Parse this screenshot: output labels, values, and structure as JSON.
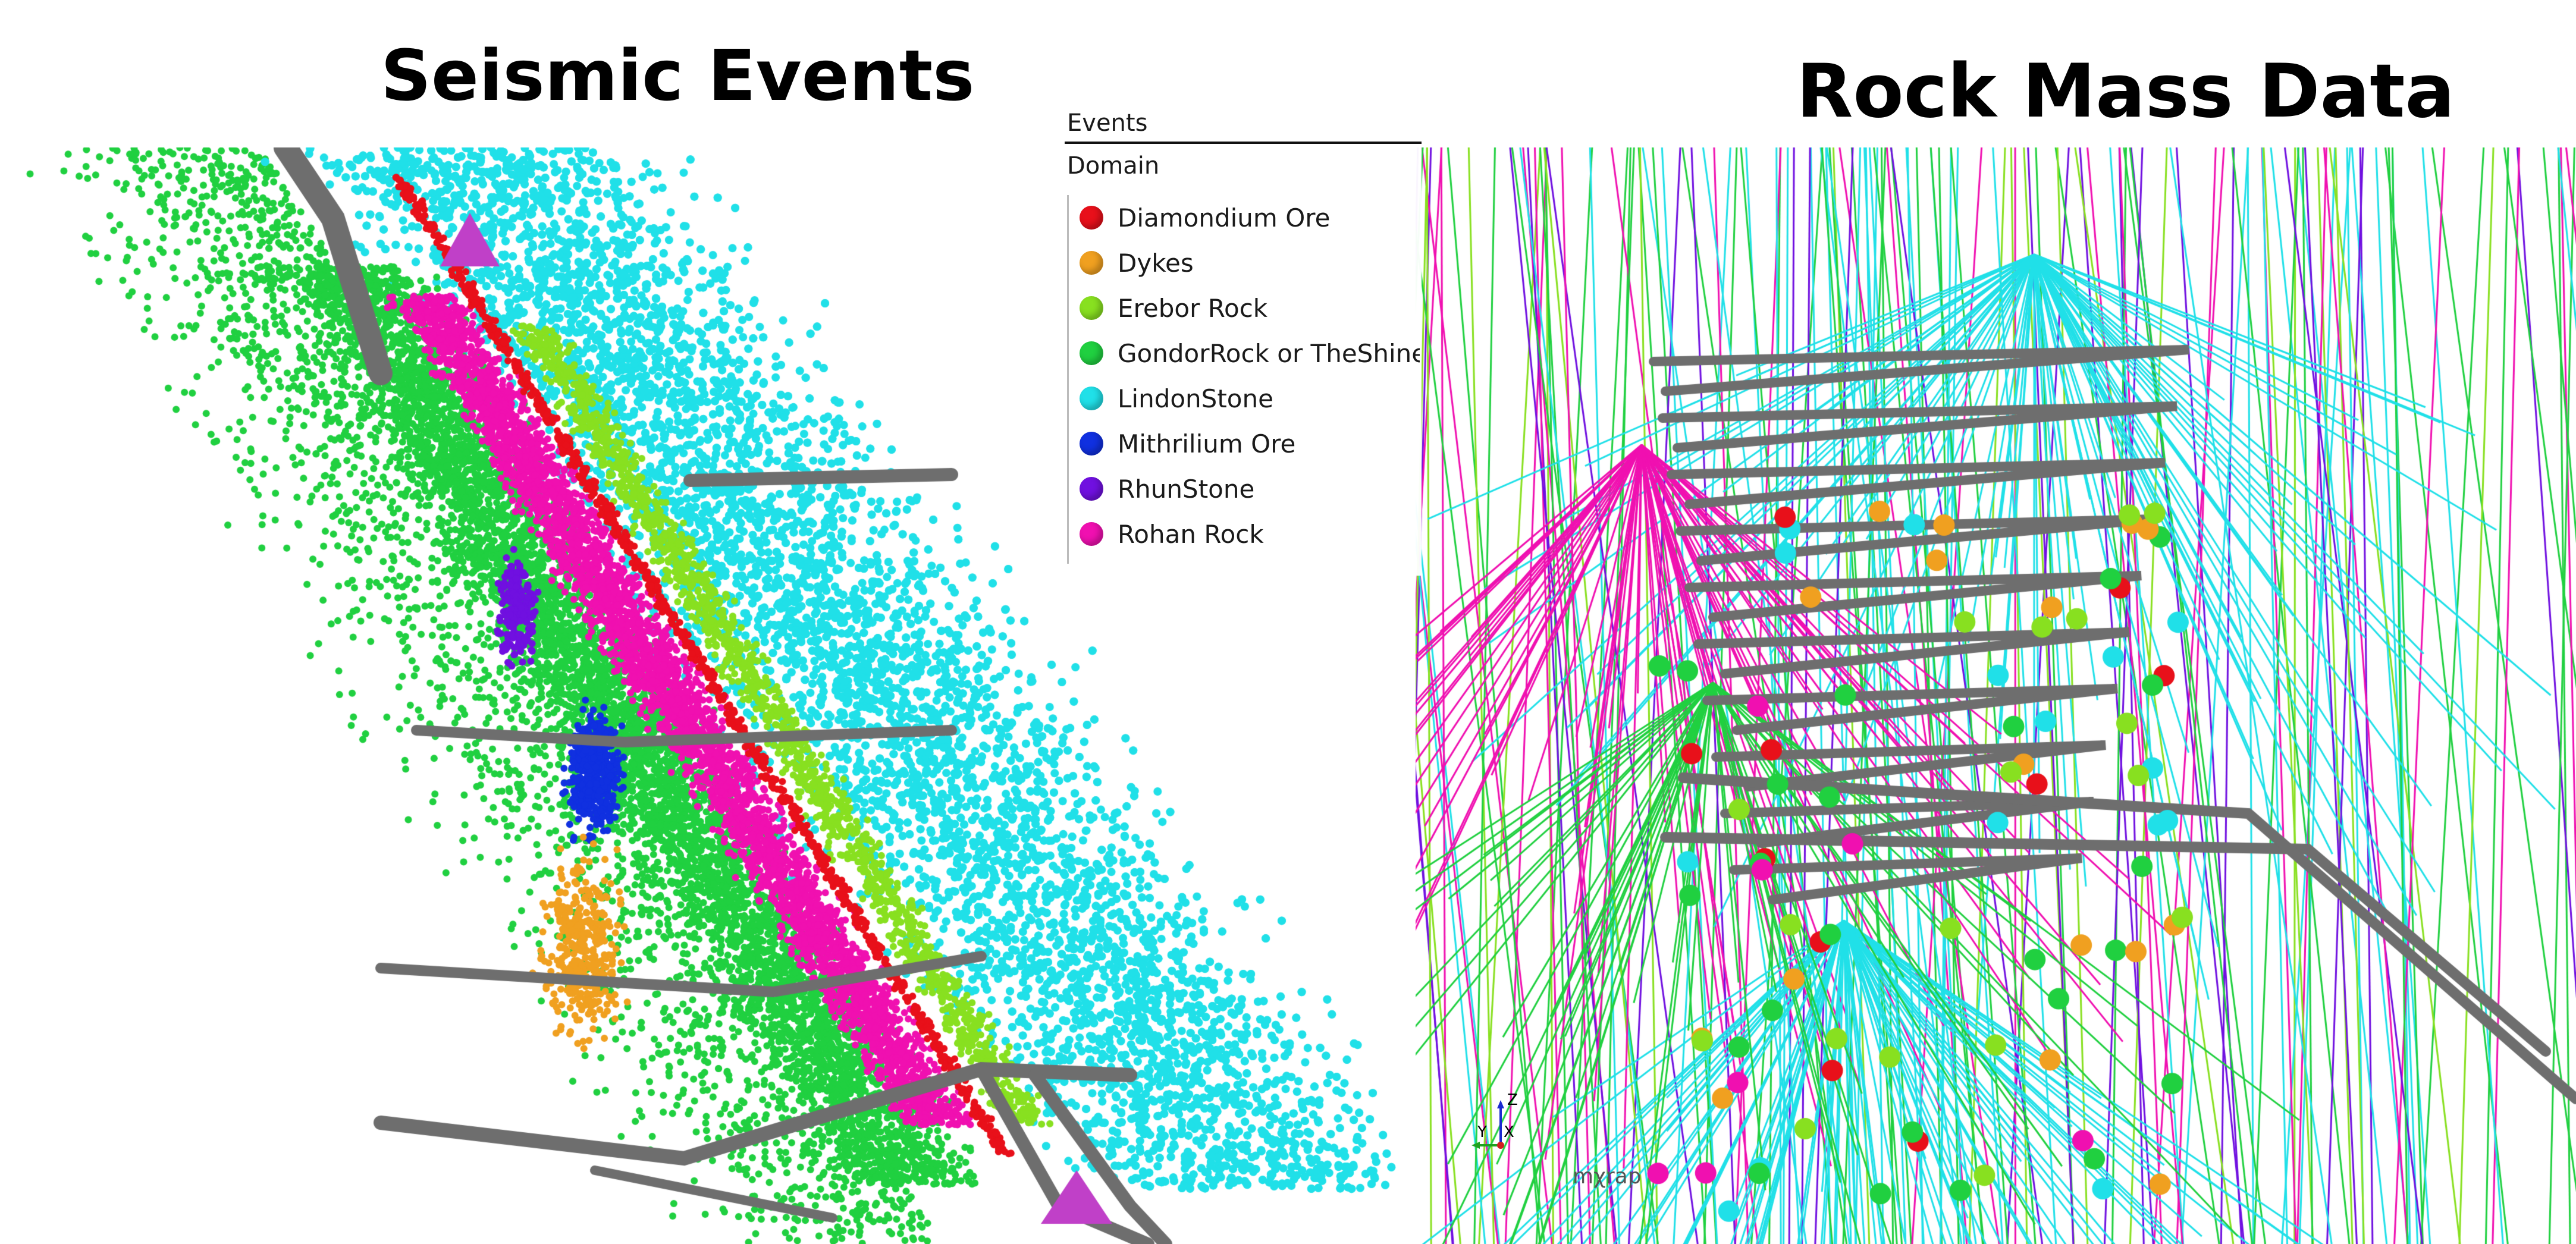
{
  "titles": {
    "left": "Seismic Events",
    "right": "Rock Mass Data"
  },
  "legend": {
    "header": "Events",
    "subheader": "Domain",
    "items": [
      {
        "label": "Diamondium Ore",
        "color": "#e8101a"
      },
      {
        "label": "Dykes",
        "color": "#f0a020"
      },
      {
        "label": "Erebor Rock",
        "color": "#88e020"
      },
      {
        "label": "GondorRock or TheShine",
        "color": "#20d040"
      },
      {
        "label": "LindonStone",
        "color": "#20e0e8"
      },
      {
        "label": "Mithrilium Ore",
        "color": "#1030e0"
      },
      {
        "label": "RhunStone",
        "color": "#7010e0"
      },
      {
        "label": "Rohan Rock",
        "color": "#f010b0"
      }
    ]
  },
  "triad": {
    "z": "Z",
    "y": "Y",
    "x": "X"
  },
  "logo": "mχrap",
  "colors": {
    "tunnel": "#6e6e6e",
    "marker": "#c040c8"
  }
}
